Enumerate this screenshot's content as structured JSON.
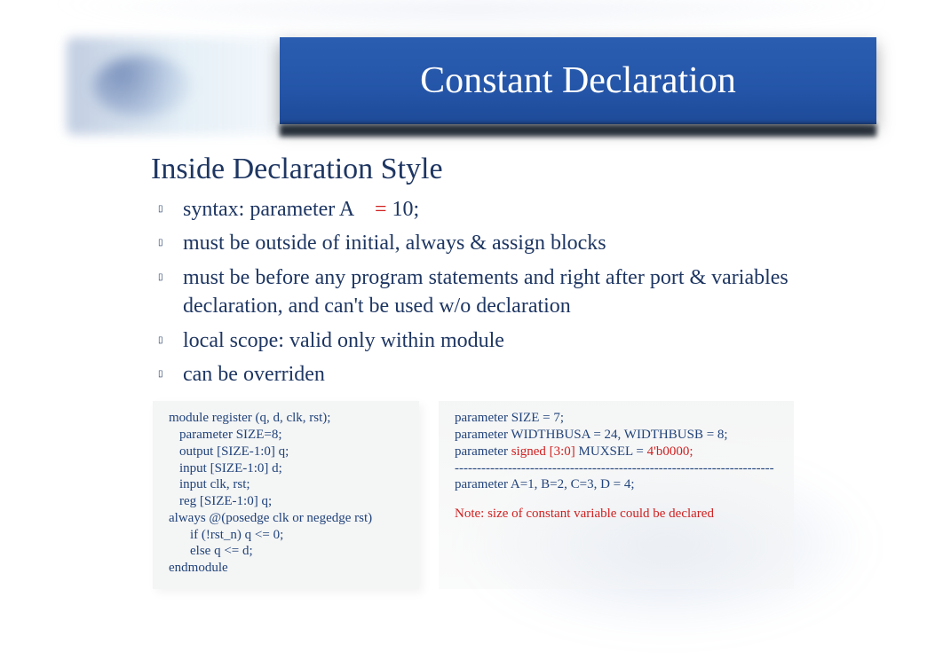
{
  "header": {
    "title": "Constant Declaration"
  },
  "main": {
    "heading_bullet": "",
    "heading": "Inside Declaration Style",
    "items": [
      {
        "bullet": "▯",
        "prefix": "syntax: parameter A ",
        "eq": "=",
        "value": " 10",
        "semi": ";"
      },
      {
        "bullet": "▯",
        "text": "must be outside of initial, always & assign blocks"
      },
      {
        "bullet": "▯",
        "text": "must be before any program statements and right after port & variables declaration, and can't be used w/o declaration"
      },
      {
        "bullet": "▯",
        "text": "local scope: valid only within module"
      },
      {
        "bullet": "▯",
        "text": "can be overriden"
      }
    ]
  },
  "code_left": {
    "l1": "module register (q, d, clk, rst);",
    "l2": "parameter SIZE=8;",
    "l3": "output [SIZE-1:0] q;",
    "l4": "input [SIZE-1:0] d;",
    "l5": "input clk, rst;",
    "l6": "reg [SIZE-1:0] q;",
    "l7": "always @(posedge clk or negedge rst)",
    "l8": "if (!rst_n) q <= 0;",
    "l9": "else q <= d;",
    "l10": "endmodule"
  },
  "code_right": {
    "r1": "parameter SIZE = 7;",
    "r2": "parameter WIDTHBUSA = 24, WIDTHBUSB = 8;",
    "r3a": "parameter ",
    "r3b": "signed [3:0]",
    "r3c": "   MUXSEL = ",
    "r3d": "4'b0000;",
    "r4": "------------------------------------------------------------------------",
    "r5": "parameter A=1, B=2, C=3, D = 4;",
    "note": "Note: size of constant variable could be declared"
  }
}
